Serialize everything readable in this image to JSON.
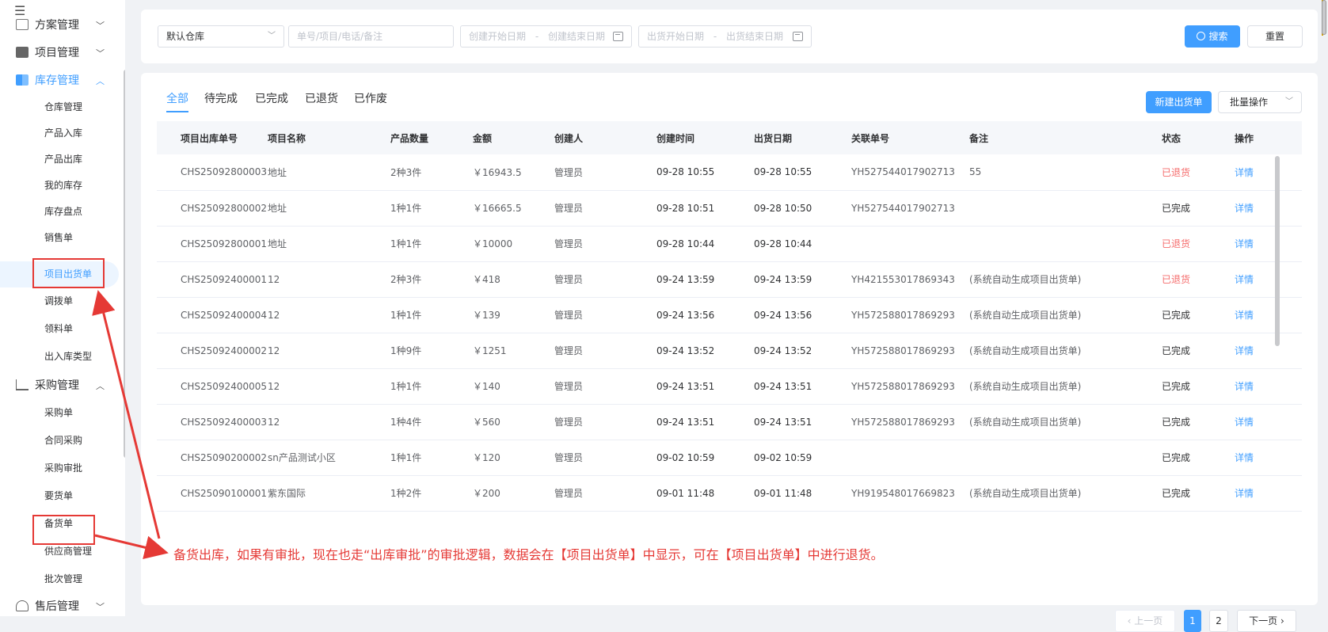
{
  "sidebar": {
    "groups": [
      {
        "label": "方案管理"
      },
      {
        "label": "项目管理"
      },
      {
        "label": "库存管理"
      },
      {
        "label": "采购管理"
      },
      {
        "label": "售后管理"
      }
    ],
    "inventory_items": [
      "仓库管理",
      "产品入库",
      "产品出库",
      "我的库存",
      "库存盘点",
      "销售单",
      "项目出货单",
      "调拨单",
      "领料单",
      "出入库类型"
    ],
    "purchase_items": [
      "采购单",
      "合同采购",
      "采购审批",
      "要货单",
      "备货单",
      "供应商管理",
      "批次管理"
    ]
  },
  "filter": {
    "warehouse": "默认仓库",
    "search_placeholder": "单号/项目/电话/备注",
    "create_start": "创建开始日期",
    "create_end": "创建结束日期",
    "ship_start": "出货开始日期",
    "ship_end": "出货结束日期",
    "date_sep": "-",
    "search_label": "搜索",
    "reset_label": "重置"
  },
  "tabs": [
    "全部",
    "待完成",
    "已完成",
    "已退货",
    "已作废"
  ],
  "actions": {
    "new_label": "新建出货单",
    "batch_label": "批量操作"
  },
  "table": {
    "headers": [
      "项目出库单号",
      "项目名称",
      "产品数量",
      "金额",
      "创建人",
      "创建时间",
      "出货日期",
      "关联单号",
      "备注",
      "状态",
      "操作"
    ],
    "rows": [
      [
        "CHS25092800003",
        "地址",
        "2种3件",
        "￥16943.5",
        "管理员",
        "09-28 10:55",
        "09-28 10:55",
        "YH527544017902713",
        "55",
        "已退货",
        "详情"
      ],
      [
        "CHS25092800002",
        "地址",
        "1种1件",
        "￥16665.5",
        "管理员",
        "09-28 10:51",
        "09-28 10:50",
        "YH527544017902713",
        "",
        "已完成",
        "详情"
      ],
      [
        "CHS25092800001",
        "地址",
        "1种1件",
        "￥10000",
        "管理员",
        "09-28 10:44",
        "09-28 10:44",
        "",
        "",
        "已退货",
        "详情"
      ],
      [
        "CHS25092400001",
        "12",
        "2种3件",
        "￥418",
        "管理员",
        "09-24 13:59",
        "09-24 13:59",
        "YH421553017869343",
        "(系统自动生成项目出货单)",
        "已退货",
        "详情"
      ],
      [
        "CHS25092400004",
        "12",
        "1种1件",
        "￥139",
        "管理员",
        "09-24 13:56",
        "09-24 13:56",
        "YH572588017869293",
        "(系统自动生成项目出货单)",
        "已完成",
        "详情"
      ],
      [
        "CHS25092400002",
        "12",
        "1种9件",
        "￥1251",
        "管理员",
        "09-24 13:52",
        "09-24 13:52",
        "YH572588017869293",
        "(系统自动生成项目出货单)",
        "已完成",
        "详情"
      ],
      [
        "CHS25092400005",
        "12",
        "1种1件",
        "￥140",
        "管理员",
        "09-24 13:51",
        "09-24 13:51",
        "YH572588017869293",
        "(系统自动生成项目出货单)",
        "已完成",
        "详情"
      ],
      [
        "CHS25092400003",
        "12",
        "1种4件",
        "￥560",
        "管理员",
        "09-24 13:51",
        "09-24 13:51",
        "YH572588017869293",
        "(系统自动生成项目出货单)",
        "已完成",
        "详情"
      ],
      [
        "CHS25090200002",
        "sn产品测试小区",
        "1种1件",
        "￥120",
        "管理员",
        "09-02 10:59",
        "09-02 10:59",
        "",
        "",
        "已完成",
        "详情"
      ],
      [
        "CHS25090100001",
        "紫东国际",
        "1种2件",
        "￥200",
        "管理员",
        "09-01 11:48",
        "09-01 11:48",
        "YH919548017669823",
        "(系统自动生成项目出货单)",
        "已完成",
        "详情"
      ]
    ]
  },
  "pagination": {
    "prev": "上一页",
    "pages": [
      "1",
      "2"
    ],
    "next": "下一页"
  },
  "annotation": "备货出库，如果有审批，现在也走“出库审批”的审批逻辑，数据会在【项目出货单】中显示，可在【项目出货单】中进行退货。",
  "colors": {
    "accent": "#409eff",
    "returned": "#f56c6c",
    "annotation": "#e53935"
  }
}
